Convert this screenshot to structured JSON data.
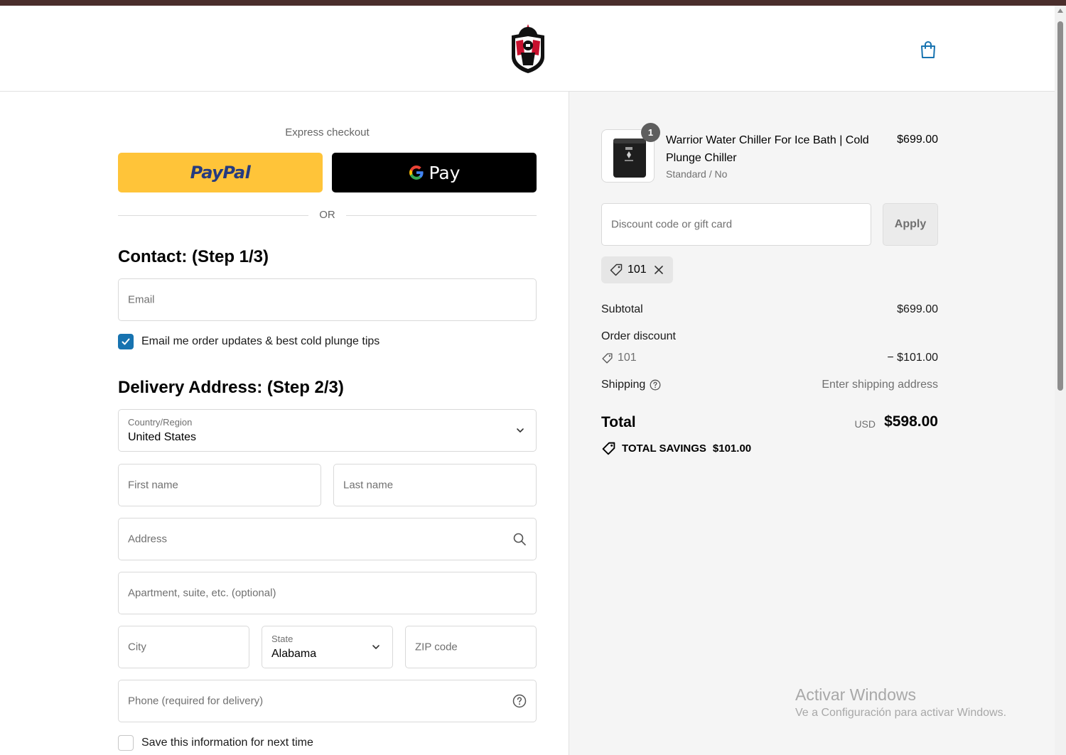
{
  "header": {
    "logo_icon": "spartan-warrior-logo",
    "cart_icon": "shopping-bag-icon"
  },
  "express": {
    "label": "Express checkout",
    "paypal_label": "PayPal",
    "gpay_label": "Pay",
    "or_label": "OR"
  },
  "contact": {
    "title": "Contact: (Step 1/3)",
    "email_placeholder": "Email",
    "newsletter_label": "Email me order updates & best cold plunge tips",
    "newsletter_checked": true
  },
  "delivery": {
    "title": "Delivery Address: (Step 2/3)",
    "country_label": "Country/Region",
    "country_value": "United States",
    "first_name_placeholder": "First name",
    "last_name_placeholder": "Last name",
    "address_placeholder": "Address",
    "apartment_placeholder": "Apartment, suite, etc. (optional)",
    "city_placeholder": "City",
    "state_label": "State",
    "state_value": "Alabama",
    "zip_placeholder": "ZIP code",
    "phone_placeholder": "Phone (required for delivery)",
    "save_info_label": "Save this information for next time",
    "save_info_checked": false
  },
  "order": {
    "item": {
      "quantity": "1",
      "name": "Warrior Water Chiller For Ice Bath | Cold Plunge Chiller",
      "variant": "Standard / No",
      "price": "$699.00"
    },
    "discount_placeholder": "Discount code or gift card",
    "apply_label": "Apply",
    "applied_code": "101",
    "subtotal_label": "Subtotal",
    "subtotal_value": "$699.00",
    "order_discount_label": "Order discount",
    "discount_code": "101",
    "discount_value": "− $101.00",
    "shipping_label": "Shipping",
    "shipping_value": "Enter shipping address",
    "total_label": "Total",
    "total_currency": "USD",
    "total_value": "$598.00",
    "savings_label": "TOTAL SAVINGS",
    "savings_value": "$101.00"
  },
  "watermark": {
    "title": "Activar Windows",
    "subtitle": "Ve a Configuración para activar Windows."
  },
  "colors": {
    "paypal_yellow": "#ffc439",
    "gpay_black": "#000000",
    "accent_blue": "#1773b0",
    "sidebar_bg": "#f5f5f5"
  }
}
